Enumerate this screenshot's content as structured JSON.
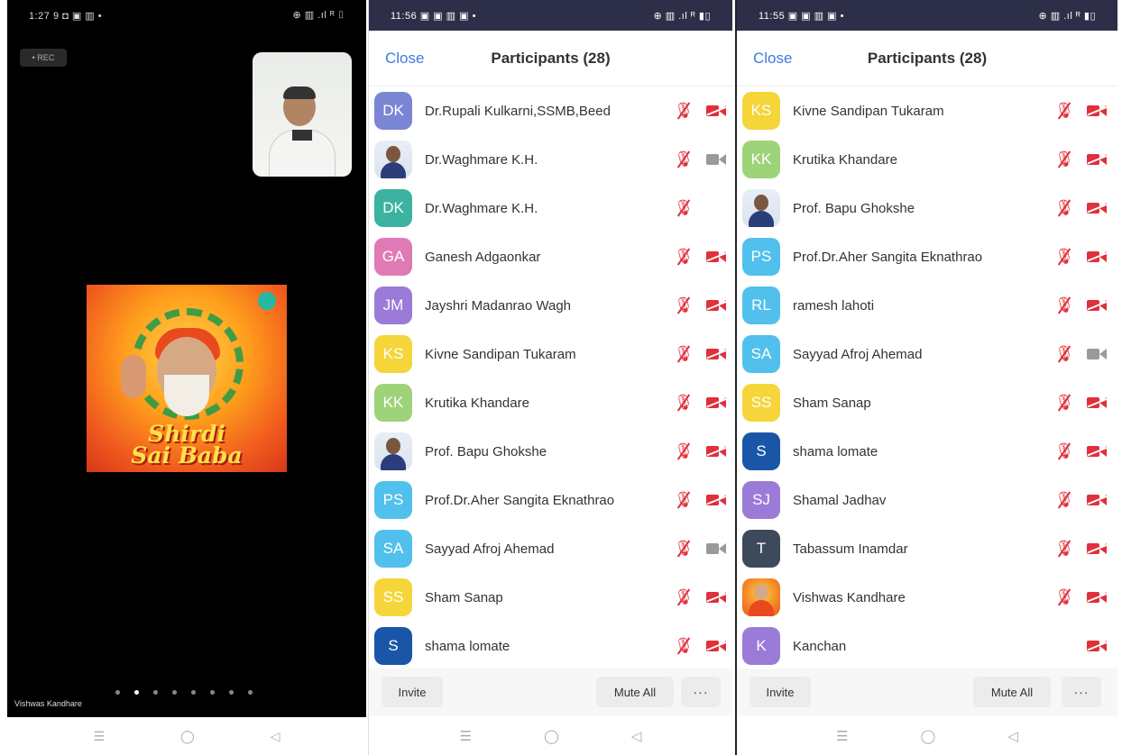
{
  "panel1": {
    "status": {
      "time": "1:27",
      "icons_left": "9 ◘ ▣ ▥ •",
      "icons_right": "⊕ ▥ .ıl ᴿ ⌷"
    },
    "rec_label": "• REC",
    "album_title_line1": "Shirdi",
    "album_title_line2": "Sai Baba",
    "speaker_name": "Vishwas Kandhare",
    "page_dots": 8,
    "active_dot": 1,
    "nav": {
      "menu": "☰",
      "home": "◯",
      "back": "◁"
    }
  },
  "panel2": {
    "status": {
      "time": "11:56",
      "icons_left": "▣ ▣ ▥ ▣ •",
      "icons_right": "⊕ ▥ .ıl ᴿ ▮▯"
    },
    "close_label": "Close",
    "title": "Participants (28)",
    "participants": [
      {
        "initials": "DK",
        "name": "Dr.Rupali Kulkarni,SSMB,Beed",
        "color": "#7a86d4",
        "photo": false,
        "video_on": false,
        "show_cam": true
      },
      {
        "initials": "",
        "name": "Dr.Waghmare K.H.",
        "color": "#3a4e8a",
        "photo": true,
        "video_on": true,
        "show_cam": true
      },
      {
        "initials": "DK",
        "name": "Dr.Waghmare K.H.",
        "color": "#3bb3a0",
        "photo": false,
        "video_on": false,
        "show_cam": false
      },
      {
        "initials": "GA",
        "name": "Ganesh Adgaonkar",
        "color": "#e07ab5",
        "photo": false,
        "video_on": false,
        "show_cam": true
      },
      {
        "initials": "JM",
        "name": "Jayshri Madanrao Wagh",
        "color": "#9b7bd8",
        "photo": false,
        "video_on": false,
        "show_cam": true
      },
      {
        "initials": "KS",
        "name": "Kivne Sandipan Tukaram",
        "color": "#f5d53a",
        "photo": false,
        "video_on": false,
        "show_cam": true
      },
      {
        "initials": "KK",
        "name": "Krutika Khandare",
        "color": "#9fd37a",
        "photo": false,
        "video_on": false,
        "show_cam": true
      },
      {
        "initials": "",
        "name": "Prof. Bapu Ghokshe",
        "color": "#3a4e8a",
        "photo": true,
        "video_on": false,
        "show_cam": true
      },
      {
        "initials": "PS",
        "name": "Prof.Dr.Aher Sangita Eknathrao",
        "color": "#52c0ec",
        "photo": false,
        "video_on": false,
        "show_cam": true
      },
      {
        "initials": "SA",
        "name": "Sayyad Afroj Ahemad",
        "color": "#52c0ec",
        "photo": false,
        "video_on": true,
        "show_cam": true
      },
      {
        "initials": "SS",
        "name": "Sham Sanap",
        "color": "#f5d53a",
        "photo": false,
        "video_on": false,
        "show_cam": true
      },
      {
        "initials": "S",
        "name": "shama lomate",
        "color": "#1a56a8",
        "photo": false,
        "video_on": false,
        "show_cam": true
      }
    ],
    "invite_label": "Invite",
    "mute_all_label": "Mute All",
    "more_label": "···",
    "nav": {
      "menu": "☰",
      "home": "◯",
      "back": "◁"
    }
  },
  "panel3": {
    "status": {
      "time": "11:55",
      "icons_left": "▣ ▣ ▥ ▣ •",
      "icons_right": "⊕ ▥ .ıl ᴿ ▮▯"
    },
    "close_label": "Close",
    "title": "Participants (28)",
    "participants": [
      {
        "initials": "KS",
        "name": "Kivne Sandipan Tukaram",
        "color": "#f5d53a",
        "photo": false,
        "video_on": false,
        "show_mic": true
      },
      {
        "initials": "KK",
        "name": "Krutika Khandare",
        "color": "#9fd37a",
        "photo": false,
        "video_on": false,
        "show_mic": true
      },
      {
        "initials": "",
        "name": "Prof. Bapu Ghokshe",
        "color": "#3a4e8a",
        "photo": true,
        "orange": false,
        "video_on": false,
        "show_mic": true
      },
      {
        "initials": "PS",
        "name": "Prof.Dr.Aher Sangita Eknathrao",
        "color": "#52c0ec",
        "photo": false,
        "video_on": false,
        "show_mic": true
      },
      {
        "initials": "RL",
        "name": "ramesh lahoti",
        "color": "#52c0ec",
        "photo": false,
        "video_on": false,
        "show_mic": true
      },
      {
        "initials": "SA",
        "name": "Sayyad Afroj Ahemad",
        "color": "#52c0ec",
        "photo": false,
        "video_on": true,
        "show_mic": true
      },
      {
        "initials": "SS",
        "name": "Sham Sanap",
        "color": "#f5d53a",
        "photo": false,
        "video_on": false,
        "show_mic": true
      },
      {
        "initials": "S",
        "name": "shama lomate",
        "color": "#1a56a8",
        "photo": false,
        "video_on": false,
        "show_mic": true
      },
      {
        "initials": "SJ",
        "name": "Shamal Jadhav",
        "color": "#9b7bd8",
        "photo": false,
        "video_on": false,
        "show_mic": true
      },
      {
        "initials": "T",
        "name": "Tabassum Inamdar",
        "color": "#3d4a5c",
        "photo": false,
        "video_on": false,
        "show_mic": true
      },
      {
        "initials": "",
        "name": "Vishwas Kandhare",
        "color": "#ef6b1e",
        "photo": true,
        "orange": true,
        "video_on": false,
        "show_mic": true
      },
      {
        "initials": "K",
        "name": "Kanchan",
        "color": "#9b7bd8",
        "photo": false,
        "video_on": false,
        "show_mic": false
      }
    ],
    "invite_label": "Invite",
    "mute_all_label": "Mute All",
    "more_label": "···",
    "nav": {
      "menu": "☰",
      "home": "◯",
      "back": "◁"
    }
  }
}
